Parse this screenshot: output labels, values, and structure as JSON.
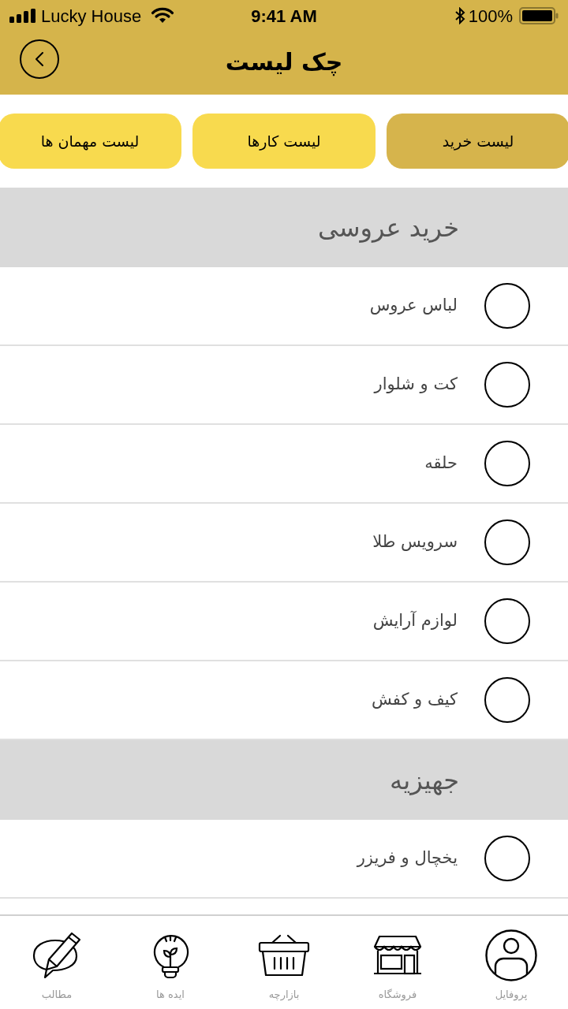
{
  "status_bar": {
    "carrier": "Lucky House",
    "time": "9:41 AM",
    "battery": "100%"
  },
  "header": {
    "title": "چک لیست"
  },
  "tabs": [
    {
      "label": "لیست خرید",
      "selected": true
    },
    {
      "label": "لیست کارها",
      "selected": false
    },
    {
      "label": "لیست مهمان ها",
      "selected": false
    }
  ],
  "sections": [
    {
      "title": "خرید عروسی",
      "items": [
        {
          "label": "لباس عروس",
          "checked": false
        },
        {
          "label": "کت و شلوار",
          "checked": false
        },
        {
          "label": "حلقه",
          "checked": false
        },
        {
          "label": "سرویس طلا",
          "checked": false
        },
        {
          "label": "لوازم آرایش",
          "checked": false
        },
        {
          "label": "کیف و کفش",
          "checked": false
        }
      ]
    },
    {
      "title": "جهیزیه",
      "items": [
        {
          "label": "یخچال و فریزر",
          "checked": false
        }
      ]
    }
  ],
  "bottom_nav": [
    {
      "label": "پروفایل",
      "kind": "profile"
    },
    {
      "label": "فروشگاه",
      "kind": "shop"
    },
    {
      "label": "بازارچه",
      "kind": "basket"
    },
    {
      "label": "ایده ها",
      "kind": "idea"
    },
    {
      "label": "مطالب",
      "kind": "articles"
    }
  ]
}
